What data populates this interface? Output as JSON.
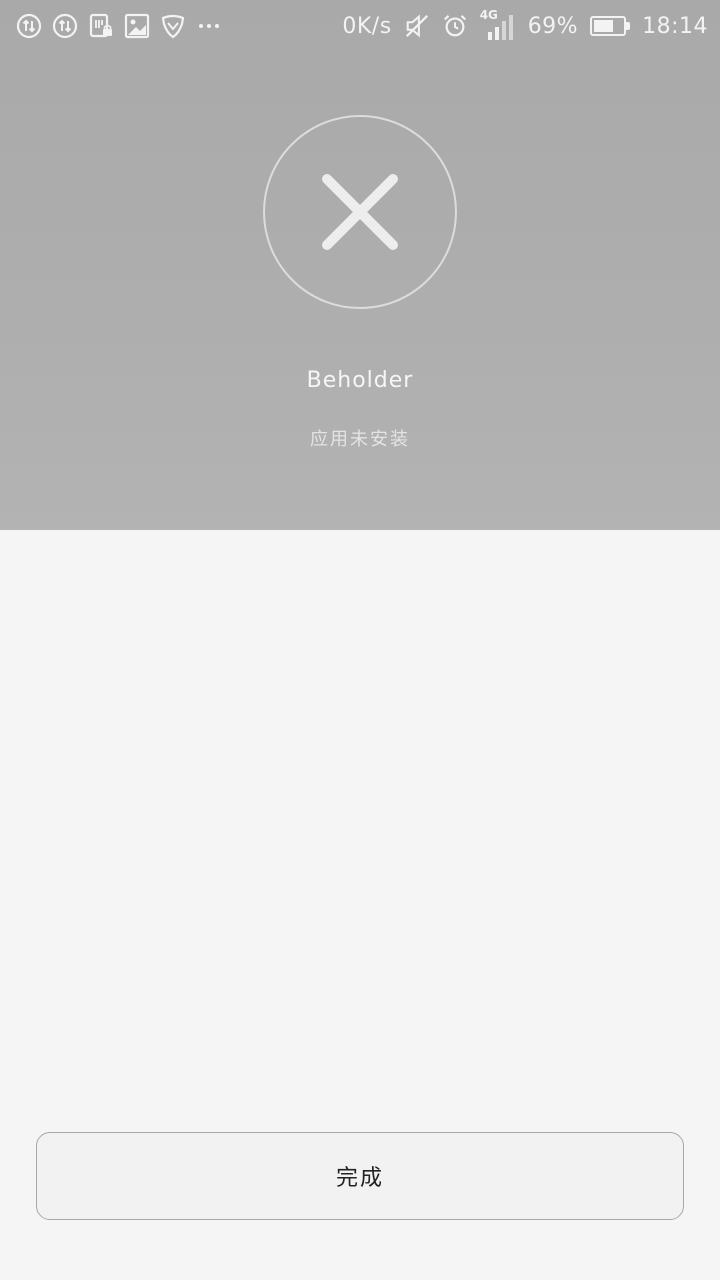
{
  "status_bar": {
    "left_icons": [
      "data-sync-icon",
      "data-sync-icon",
      "sim-lock-icon",
      "image-icon",
      "shield-icon",
      "more-icon"
    ],
    "more_label": "···",
    "net_speed": "0K/s",
    "network_type": "4G",
    "battery_percent_text": "69%",
    "battery_level": 0.69,
    "time": "18:14"
  },
  "result": {
    "status_icon": "close-icon",
    "app_name": "Beholder",
    "status_text": "应用未安装"
  },
  "footer": {
    "done_label": "完成"
  },
  "colors": {
    "header_bg": "#acacac",
    "page_bg": "#f5f5f5",
    "icon_light": "#ededed",
    "button_border": "#a8a8a8"
  }
}
